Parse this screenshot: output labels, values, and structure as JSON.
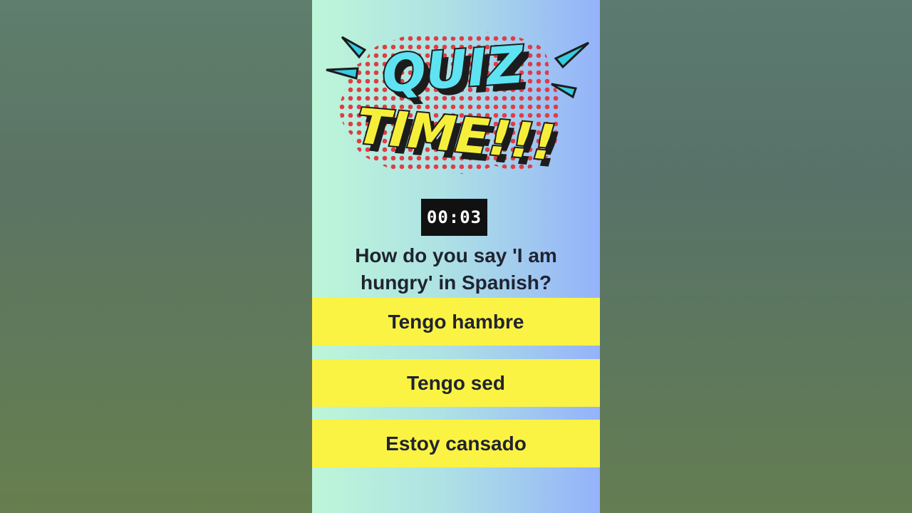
{
  "logo": {
    "line1": "QUIZ",
    "line2": "TIME!!!",
    "colors": {
      "line1_fill": "#5ee3f2",
      "line2_fill": "#f6ef3a",
      "shadow": "#1c1c1c",
      "dots": "#e03c46",
      "rays": "#37cce0"
    }
  },
  "timer": {
    "value": "00:03"
  },
  "question": {
    "text": "How do you say 'I am hungry' in Spanish?"
  },
  "options": [
    {
      "label": "Tengo hambre"
    },
    {
      "label": "Tengo sed"
    },
    {
      "label": "Estoy cansado"
    }
  ],
  "colors": {
    "option_background": "#fbf343",
    "text_dark": "#1f2330",
    "timer_background": "#111111"
  }
}
